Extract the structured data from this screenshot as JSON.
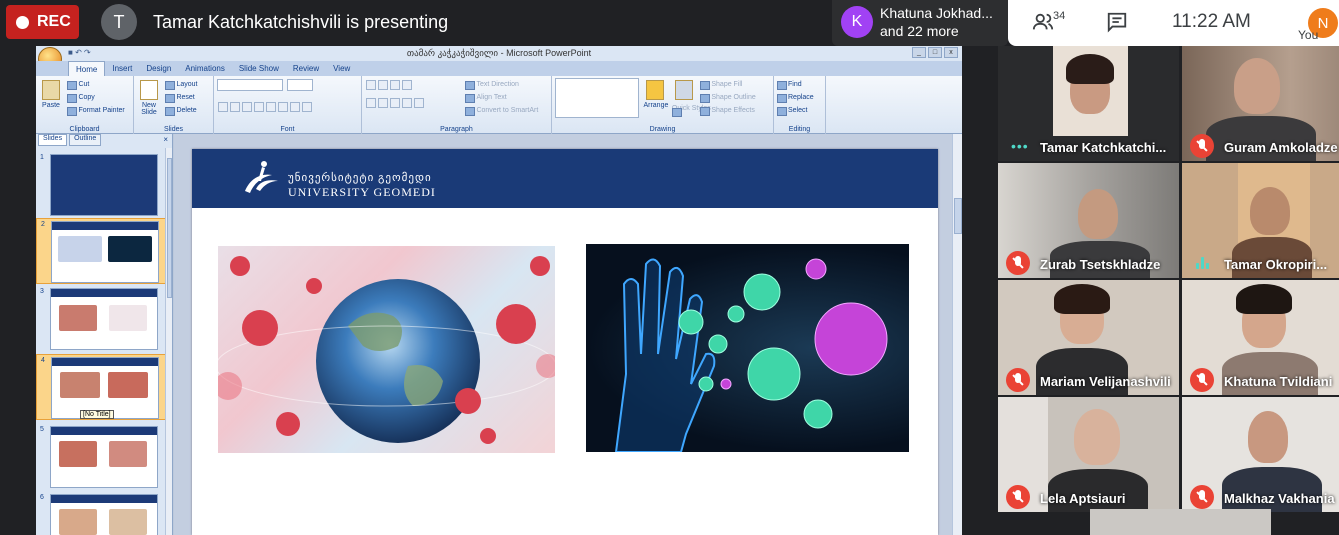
{
  "meet": {
    "rec_label": "REC",
    "presenter_initial": "T",
    "presenting_text": "Tamar Katchkatchishvili is presenting",
    "speaker_initial": "K",
    "speaker_name": "Khatuna Jokhad...",
    "speaker_more": "and 22 more",
    "people_count": "34",
    "time": "11:22 AM",
    "you_initial": "N",
    "you_label": "You"
  },
  "powerpoint": {
    "window_title": "თამარ კაჭკაჭიშვილი - Microsoft PowerPoint",
    "tabs": [
      "Home",
      "Insert",
      "Design",
      "Animations",
      "Slide Show",
      "Review",
      "View"
    ],
    "active_tab": "Home",
    "groups": {
      "clipboard": {
        "label": "Clipboard",
        "paste": "Paste",
        "cut": "Cut",
        "copy": "Copy",
        "format_painter": "Format Painter"
      },
      "slides": {
        "label": "Slides",
        "new_slide": "New Slide",
        "layout": "Layout",
        "reset": "Reset",
        "delete": "Delete"
      },
      "font": {
        "label": "Font"
      },
      "paragraph": {
        "label": "Paragraph",
        "text_direction": "Text Direction",
        "align_text": "Align Text",
        "convert": "Convert to SmartArt"
      },
      "drawing": {
        "label": "Drawing",
        "arrange": "Arrange",
        "quick_styles": "Quick Styles",
        "shape_fill": "Shape Fill",
        "shape_outline": "Shape Outline",
        "shape_effects": "Shape Effects"
      },
      "editing": {
        "label": "Editing",
        "find": "Find",
        "replace": "Replace",
        "select": "Select"
      }
    },
    "panel_tabs": [
      "Slides",
      "Outline"
    ],
    "thumbnails": [
      "1",
      "2",
      "3",
      "4",
      "5",
      "6"
    ],
    "tooltip": "[No Title]",
    "slide": {
      "university_ka": "უნივერსიტეტი გეომედი",
      "university_en": "UNIVERSITY GEOMEDI"
    }
  },
  "participants": [
    {
      "name": "Tamar Katchkatchi...",
      "status": "speaking-dots"
    },
    {
      "name": "Guram Amkoladze",
      "status": "muted"
    },
    {
      "name": "Zurab Tsetskhladze",
      "status": "muted"
    },
    {
      "name": "Tamar Okropiri...",
      "status": "speaking-bars"
    },
    {
      "name": "Mariam Velijanashvili",
      "status": "muted"
    },
    {
      "name": "Khatuna Tvildiani",
      "status": "muted"
    },
    {
      "name": "Lela Aptsiauri",
      "status": "muted"
    },
    {
      "name": "Malkhaz Vakhania",
      "status": "muted"
    }
  ],
  "colors": {
    "rec": "#c5221f",
    "muted": "#ea4335",
    "speaking": "#4fd8c7",
    "slide_header": "#1a3a77"
  }
}
